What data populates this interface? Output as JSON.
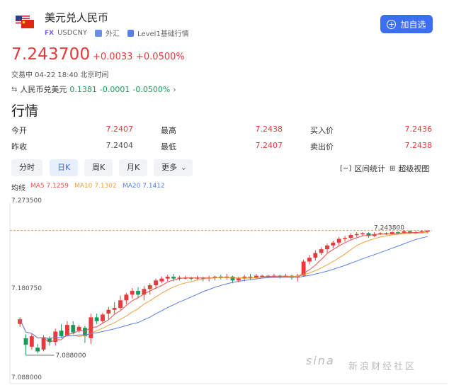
{
  "header": {
    "title": "美元兑人民币",
    "fx_badge": "FX",
    "symbol": "USDCNY",
    "category": "外汇",
    "level": "Level1基础行情",
    "add_button": "加自选"
  },
  "quote": {
    "price": "7.243700",
    "change": "+0.0033",
    "change_pct": "+0.0500%",
    "status": "交易中 04-22 18:40 北京时间",
    "reverse_label": "人民币兑美元",
    "reverse_price": "0.1381",
    "reverse_change": "-0.0001",
    "reverse_pct": "-0.0500%"
  },
  "market": {
    "heading": "行情",
    "rows": [
      [
        {
          "k": "今开",
          "v": "7.2407"
        },
        {
          "k": "最高",
          "v": "7.2438"
        },
        {
          "k": "买入价",
          "v": "7.2436"
        }
      ],
      [
        {
          "k": "昨收",
          "v": "7.2404"
        },
        {
          "k": "最低",
          "v": "7.2407"
        },
        {
          "k": "卖出价",
          "v": "7.2438"
        }
      ]
    ]
  },
  "tabs": [
    "分时",
    "日K",
    "周K",
    "月K",
    "更多"
  ],
  "active_tab": "日K",
  "tools": {
    "range": "区间统计",
    "super": "超级视图"
  },
  "ma": {
    "label": "均线",
    "ma5": "MA5 7.1259",
    "ma10": "MA10 7.1302",
    "ma20": "MA20 7.1412"
  },
  "colors": {
    "up": "#e83a3a",
    "down": "#1a9a5a",
    "accent": "#3b6ef0",
    "ma5": "#e8504a",
    "ma10": "#f0a040",
    "ma20": "#5a7fe6"
  },
  "chart_data": {
    "type": "candlestick",
    "y_labels": [
      "7.273500",
      "7.180750",
      "7.088000"
    ],
    "ylim": [
      7.088,
      7.2735
    ],
    "last_price": 7.2438,
    "last_label": "7.243800",
    "low_label": "7.088000",
    "candles": [
      [
        7.145,
        7.15,
        7.142,
        7.152
      ],
      [
        7.13,
        7.123,
        7.112,
        7.134
      ],
      [
        7.121,
        7.132,
        7.118,
        7.135
      ],
      [
        7.12,
        7.116,
        7.114,
        7.124
      ],
      [
        7.118,
        7.131,
        7.116,
        7.133
      ],
      [
        7.13,
        7.126,
        7.122,
        7.132
      ],
      [
        7.126,
        7.137,
        7.122,
        7.14
      ],
      [
        7.138,
        7.132,
        7.13,
        7.145
      ],
      [
        7.133,
        7.144,
        7.132,
        7.148
      ],
      [
        7.144,
        7.136,
        7.134,
        7.148
      ],
      [
        7.138,
        7.142,
        7.136,
        7.144
      ],
      [
        7.141,
        7.132,
        7.125,
        7.143
      ],
      [
        7.13,
        7.152,
        7.124,
        7.156
      ],
      [
        7.152,
        7.148,
        7.145,
        7.156
      ],
      [
        7.148,
        7.155,
        7.146,
        7.157
      ],
      [
        7.156,
        7.16,
        7.15,
        7.163
      ],
      [
        7.16,
        7.162,
        7.156,
        7.168
      ],
      [
        7.162,
        7.17,
        7.16,
        7.175
      ],
      [
        7.17,
        7.176,
        7.166,
        7.178
      ],
      [
        7.176,
        7.18,
        7.172,
        7.183
      ],
      [
        7.18,
        7.176,
        7.172,
        7.184
      ],
      [
        7.176,
        7.182,
        7.17,
        7.185
      ],
      [
        7.182,
        7.186,
        7.176,
        7.188
      ],
      [
        7.186,
        7.191,
        7.182,
        7.193
      ],
      [
        7.19,
        7.193,
        7.188,
        7.195
      ],
      [
        7.193,
        7.195,
        7.19,
        7.197
      ],
      [
        7.195,
        7.193,
        7.19,
        7.198
      ],
      [
        7.193,
        7.194,
        7.191,
        7.196
      ],
      [
        7.194,
        7.194,
        7.192,
        7.196
      ],
      [
        7.194,
        7.193,
        7.191,
        7.195
      ],
      [
        7.193,
        7.194,
        7.191,
        7.196
      ],
      [
        7.194,
        7.193,
        7.19,
        7.195
      ],
      [
        7.193,
        7.194,
        7.19,
        7.196
      ],
      [
        7.194,
        7.195,
        7.191,
        7.196
      ],
      [
        7.195,
        7.194,
        7.192,
        7.197
      ],
      [
        7.194,
        7.195,
        7.192,
        7.198
      ],
      [
        7.195,
        7.191,
        7.188,
        7.196
      ],
      [
        7.191,
        7.193,
        7.189,
        7.195
      ],
      [
        7.193,
        7.195,
        7.19,
        7.197
      ],
      [
        7.195,
        7.194,
        7.192,
        7.198
      ],
      [
        7.194,
        7.196,
        7.193,
        7.198
      ],
      [
        7.196,
        7.196,
        7.194,
        7.197
      ],
      [
        7.196,
        7.195,
        7.194,
        7.197
      ],
      [
        7.195,
        7.196,
        7.194,
        7.198
      ],
      [
        7.196,
        7.195,
        7.193,
        7.197
      ],
      [
        7.195,
        7.196,
        7.194,
        7.198
      ],
      [
        7.196,
        7.194,
        7.192,
        7.197
      ],
      [
        7.194,
        7.196,
        7.19,
        7.198
      ],
      [
        7.196,
        7.211,
        7.195,
        7.213
      ],
      [
        7.211,
        7.215,
        7.208,
        7.218
      ],
      [
        7.215,
        7.22,
        7.212,
        7.223
      ],
      [
        7.22,
        7.224,
        7.218,
        7.226
      ],
      [
        7.224,
        7.228,
        7.22,
        7.23
      ],
      [
        7.228,
        7.231,
        7.225,
        7.233
      ],
      [
        7.231,
        7.235,
        7.228,
        7.237
      ],
      [
        7.235,
        7.236,
        7.232,
        7.238
      ],
      [
        7.236,
        7.239,
        7.234,
        7.241
      ],
      [
        7.239,
        7.24,
        7.237,
        7.242
      ],
      [
        7.24,
        7.241,
        7.238,
        7.242
      ],
      [
        7.241,
        7.238,
        7.236,
        7.242
      ],
      [
        7.238,
        7.24,
        7.237,
        7.242
      ],
      [
        7.24,
        7.241,
        7.239,
        7.242
      ],
      [
        7.241,
        7.24,
        7.239,
        7.242
      ],
      [
        7.24,
        7.242,
        7.239,
        7.243
      ],
      [
        7.242,
        7.241,
        7.24,
        7.243
      ],
      [
        7.241,
        7.243,
        7.24,
        7.244
      ],
      [
        7.243,
        7.241,
        7.24,
        7.244
      ],
      [
        7.241,
        7.242,
        7.24,
        7.243
      ],
      [
        7.242,
        7.243,
        7.241,
        7.244
      ],
      [
        7.243,
        7.2437,
        7.2407,
        7.2438
      ]
    ]
  },
  "watermark": {
    "logo": "sina",
    "text": "新浪财经社区"
  }
}
